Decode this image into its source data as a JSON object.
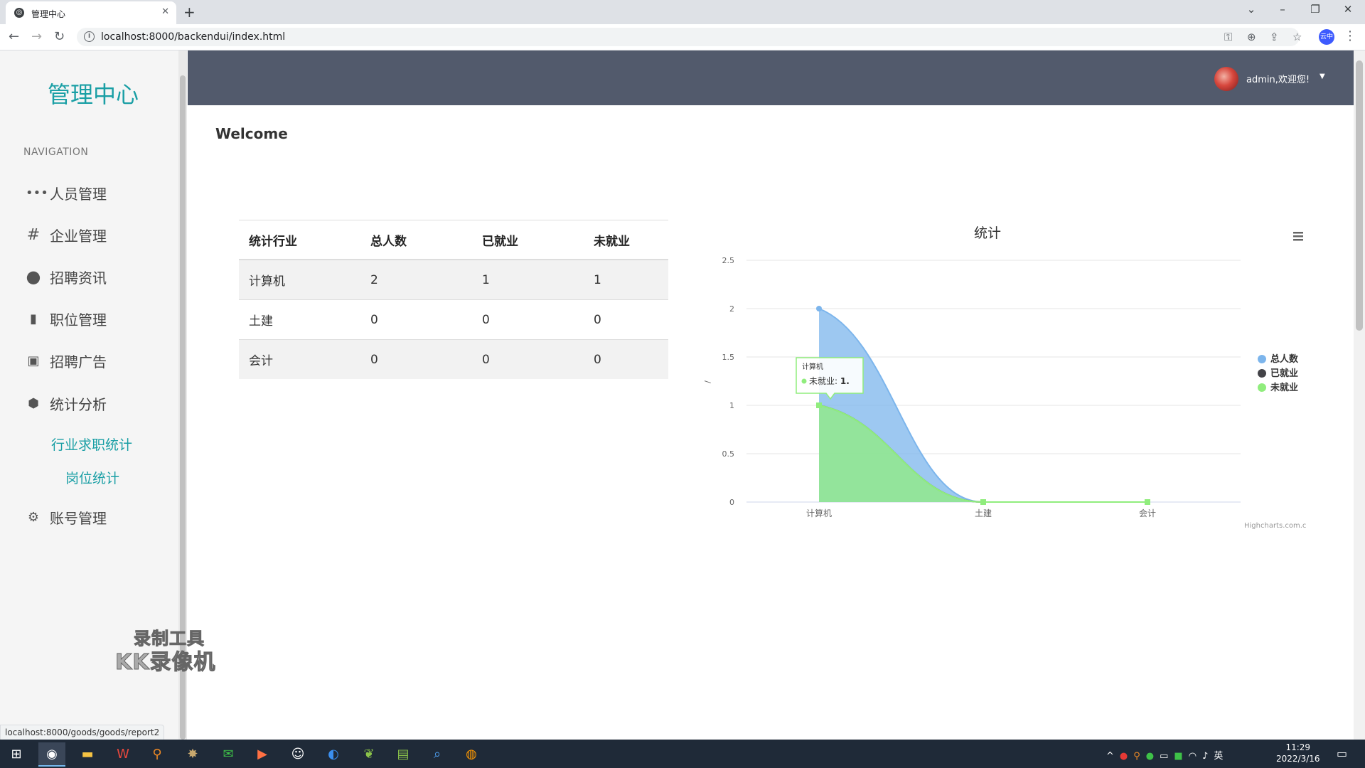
{
  "browser": {
    "tab_title": "管理中心",
    "new_tab": "+",
    "url": "localhost:8000/backendui/index.html",
    "profile_label": "云中",
    "status_url": "localhost:8000/goods/goods/report2"
  },
  "sidebar": {
    "brand": "管理中心",
    "nav_label": "NAVIGATION",
    "items": [
      {
        "label": "人员管理",
        "icon": "more-dots-icon"
      },
      {
        "label": "企业管理",
        "icon": "hash-icon"
      },
      {
        "label": "招聘资讯",
        "icon": "circle-icon"
      },
      {
        "label": "职位管理",
        "icon": "file-icon"
      },
      {
        "label": "招聘广告",
        "icon": "image-icon"
      },
      {
        "label": "统计分析",
        "icon": "cube-icon"
      },
      {
        "label": "账号管理",
        "icon": "gears-icon"
      }
    ],
    "subitems": [
      {
        "label": "行业求职统计"
      },
      {
        "label": "岗位统计"
      }
    ]
  },
  "header": {
    "username": "admin,欢迎您!"
  },
  "main": {
    "welcome": "Welcome",
    "table": {
      "headers": [
        "统计行业",
        "总人数",
        "已就业",
        "未就业"
      ],
      "rows": [
        [
          "计算机",
          "2",
          "1",
          "1"
        ],
        [
          "土建",
          "0",
          "0",
          "0"
        ],
        [
          "会计",
          "0",
          "0",
          "0"
        ]
      ]
    }
  },
  "chart_data": {
    "type": "area",
    "title": "统计",
    "xlabel": "",
    "ylabel": "/",
    "categories": [
      "计算机",
      "土建",
      "会计"
    ],
    "ylim": [
      0,
      2.5
    ],
    "yticks": [
      "0",
      "0.5",
      "1",
      "1.5",
      "2",
      "2.5"
    ],
    "grid": true,
    "legend_position": "right",
    "series": [
      {
        "name": "总人数",
        "values": [
          2,
          0,
          0
        ],
        "color": "#7cb5ec"
      },
      {
        "name": "已就业",
        "values": [
          1,
          0,
          0
        ],
        "color": "#434348"
      },
      {
        "name": "未就业",
        "values": [
          1,
          0,
          0
        ],
        "color": "#90ed7d"
      }
    ],
    "tooltip": {
      "category": "计算机",
      "series": "未就业",
      "value_text": "1."
    },
    "credits": "Highcharts.com.c"
  },
  "watermark": {
    "line1": "录制工具",
    "line2": "KK录像机"
  },
  "taskbar": {
    "time": "11:29",
    "date": "2022/3/16",
    "ime": "英"
  }
}
